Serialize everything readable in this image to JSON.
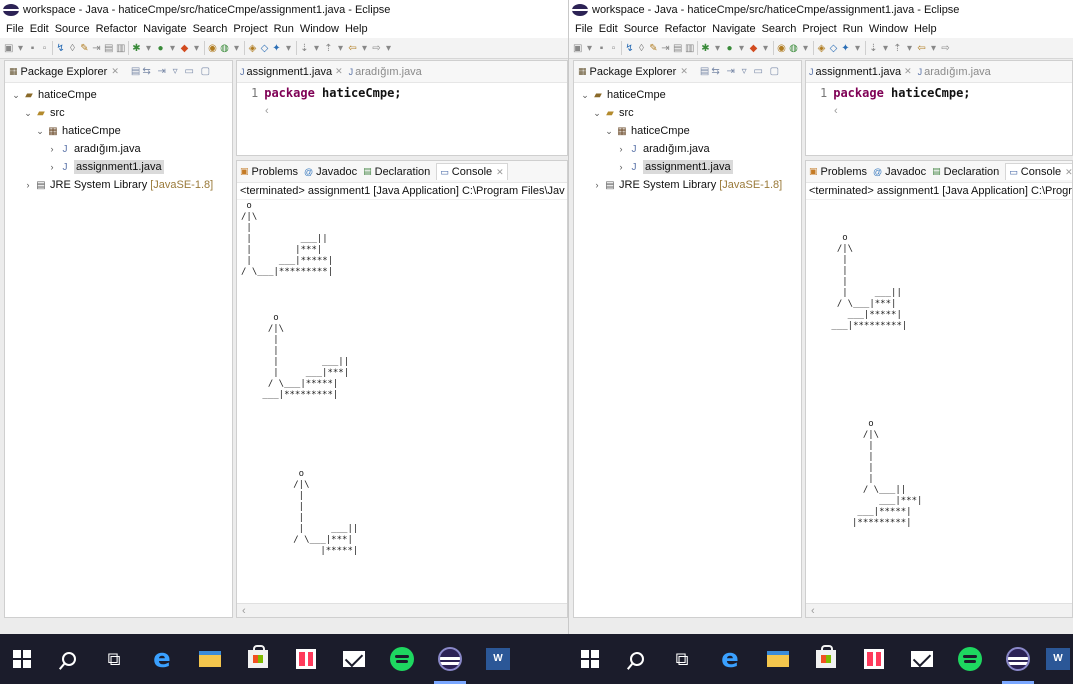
{
  "window": {
    "title": "workspace - Java - haticeCmpe/src/haticeCmpe/assignment1.java - Eclipse",
    "menu": [
      "File",
      "Edit",
      "Source",
      "Refactor",
      "Navigate",
      "Search",
      "Project",
      "Run",
      "Window",
      "Help"
    ]
  },
  "package_explorer": {
    "title": "Package Explorer",
    "tree": {
      "project": "haticeCmpe",
      "src": "src",
      "package": "haticeCmpe",
      "file1": "aradığım.java",
      "file2": "assignment1.java",
      "jre_label": "JRE System Library",
      "jre_version": "[JavaSE-1.8]"
    }
  },
  "editor": {
    "tabs": [
      {
        "label": "assignment1.java",
        "active": true
      },
      {
        "label": "aradığım.java",
        "active": false
      }
    ],
    "code": {
      "line_no": "1",
      "keyword": "package",
      "name": "haticeCmpe;"
    }
  },
  "console": {
    "tabs": [
      "Problems",
      "Javadoc",
      "Declaration",
      "Console"
    ],
    "terminated": "<terminated> assignment1 [Java Application] C:\\Program Files\\Jav",
    "terminated_right": "<terminated> assignment1 [Java Application] C:\\Progra",
    "frames_left": [
      " o\n/|\\\n |\n |         ___||\n |        |***|\n |     ___|*****|\n/ \\___|*********|",
      "   o\n  /|\\\n   |\n   |\n   |        ___||\n   |     ___|***|\n  / \\___|*****|\n ___|*********|",
      "    o\n   /|\\\n    |\n    |\n    |\n    |     ___||\n   / \\___|***|\n        |*****|"
    ],
    "frames_right": [
      "   o\n  /|\\\n   |\n   |\n   |\n   |     ___||\n  / \\___|***|\n    ___|*****|\n ___|*********|",
      "   o\n  /|\\\n   |\n   |\n   |\n   |\n  / \\___||\n     ___|***|\n ___|*****|\n|*********|"
    ]
  },
  "taskbar": {
    "items": [
      "start-windows",
      "search",
      "task-view",
      "edge",
      "file-explorer",
      "store",
      "gift-app",
      "mail",
      "spotify",
      "eclipse",
      "word"
    ]
  }
}
